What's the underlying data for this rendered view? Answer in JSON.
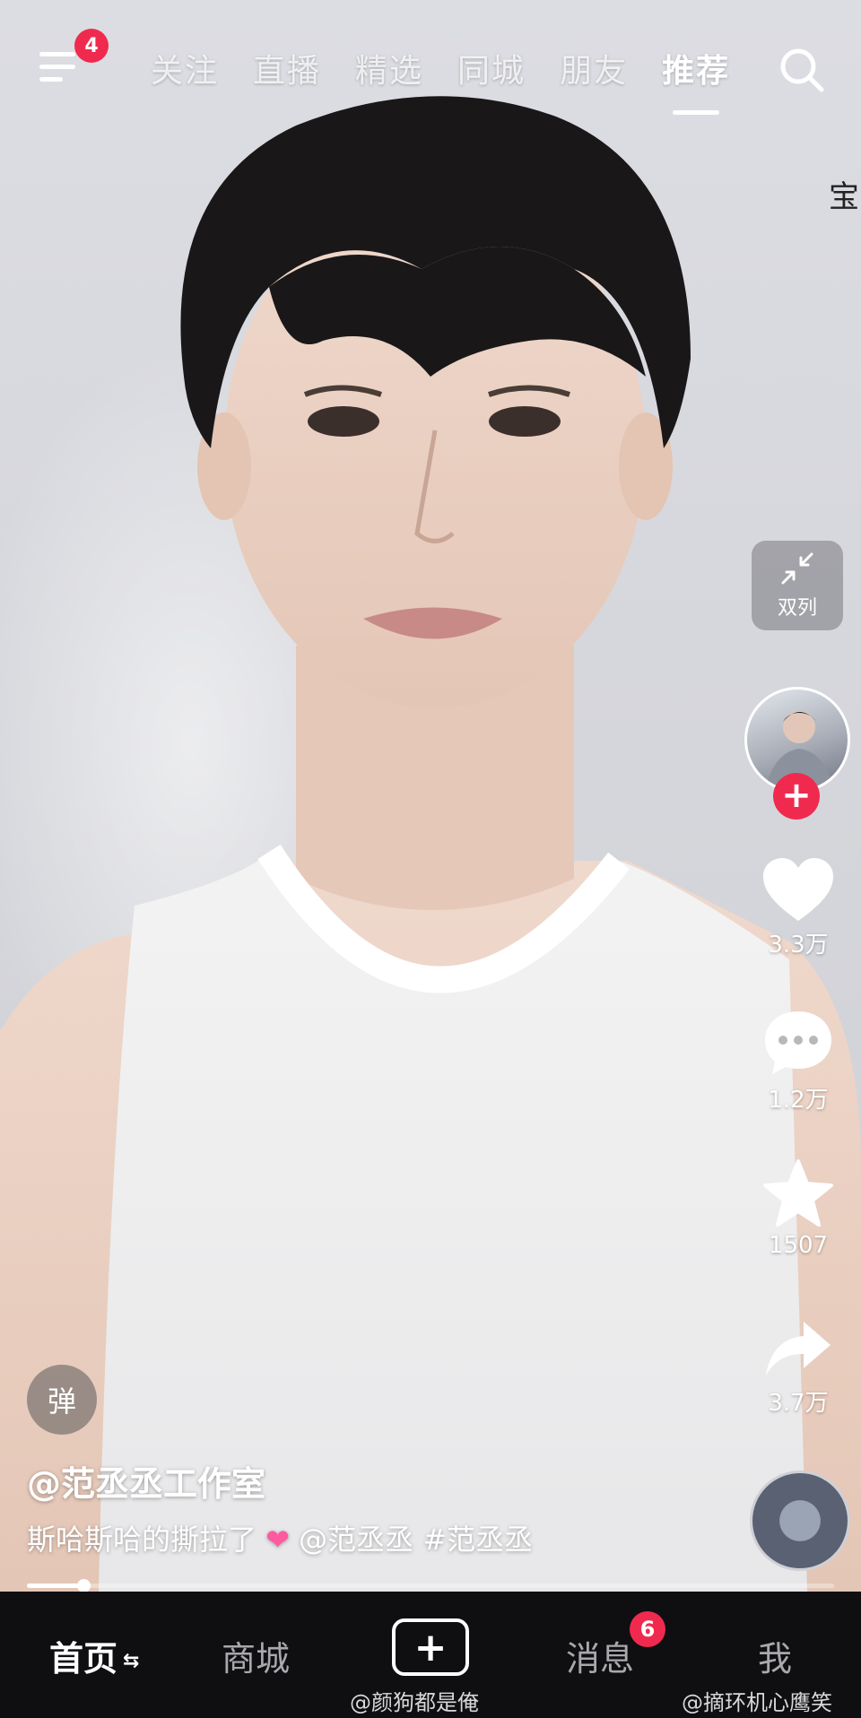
{
  "topnav": {
    "menu_badge": "4",
    "tabs": [
      "关注",
      "直播",
      "精选",
      "同城",
      "朋友",
      "推荐"
    ],
    "active_tab": "推荐",
    "edge_text": "宝"
  },
  "rail": {
    "dual_label": "双列",
    "likes": "3.3万",
    "comments": "1.2万",
    "favorites": "1507",
    "shares": "3.7万"
  },
  "video": {
    "danmu_label": "弹",
    "author": "@范丞丞工作室",
    "caption_text": "斯哈斯哈的撕拉了",
    "caption_tags": "@范丞丞 #范丞丞",
    "progress": 0.07
  },
  "bottomnav": {
    "home": "首页",
    "mall": "商城",
    "messages": "消息",
    "messages_badge": "6",
    "me": "我",
    "watermark_left": "@颜狗都是俺",
    "watermark_right": "@摘环机心鹰笑"
  }
}
